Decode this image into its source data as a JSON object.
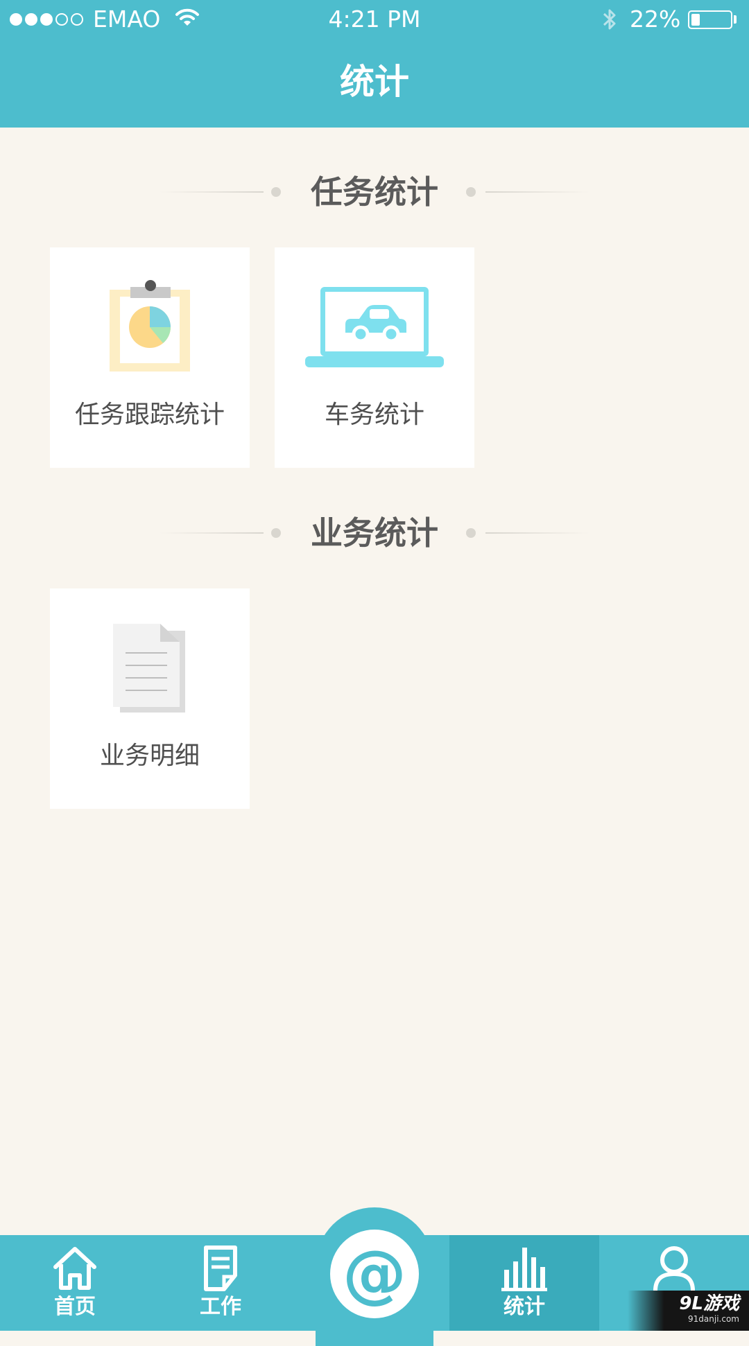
{
  "status_bar": {
    "carrier": "EMAO",
    "time": "4:21 PM",
    "battery": "22%",
    "battery_level": 0.22,
    "signal_bars_filled": 3,
    "signal_bars_total": 5
  },
  "nav": {
    "title": "统计"
  },
  "sections": [
    {
      "title": "任务统计",
      "cards": [
        {
          "label": "任务跟踪统计",
          "icon": "clipboard-pie-chart-icon"
        },
        {
          "label": "车务统计",
          "icon": "laptop-car-icon"
        }
      ]
    },
    {
      "title": "业务统计",
      "cards": [
        {
          "label": "业务明细",
          "icon": "document-icon"
        }
      ]
    }
  ],
  "tabbar": {
    "tabs": [
      {
        "label": "首页",
        "icon": "home-icon"
      },
      {
        "label": "工作",
        "icon": "work-document-icon"
      },
      {
        "label": "",
        "icon": "at-sign-icon",
        "glyph": "@"
      },
      {
        "label": "统计",
        "icon": "bar-chart-icon",
        "active": true
      },
      {
        "label": "",
        "icon": "user-icon"
      }
    ]
  },
  "watermark": {
    "text": "9L游戏",
    "sub": "91danji.com"
  },
  "colors": {
    "primary": "#4dbdcd",
    "tab_active": "#3aabbb",
    "background": "#f9f5ee",
    "card": "#ffffff",
    "section_title": "#5b5b5b"
  }
}
